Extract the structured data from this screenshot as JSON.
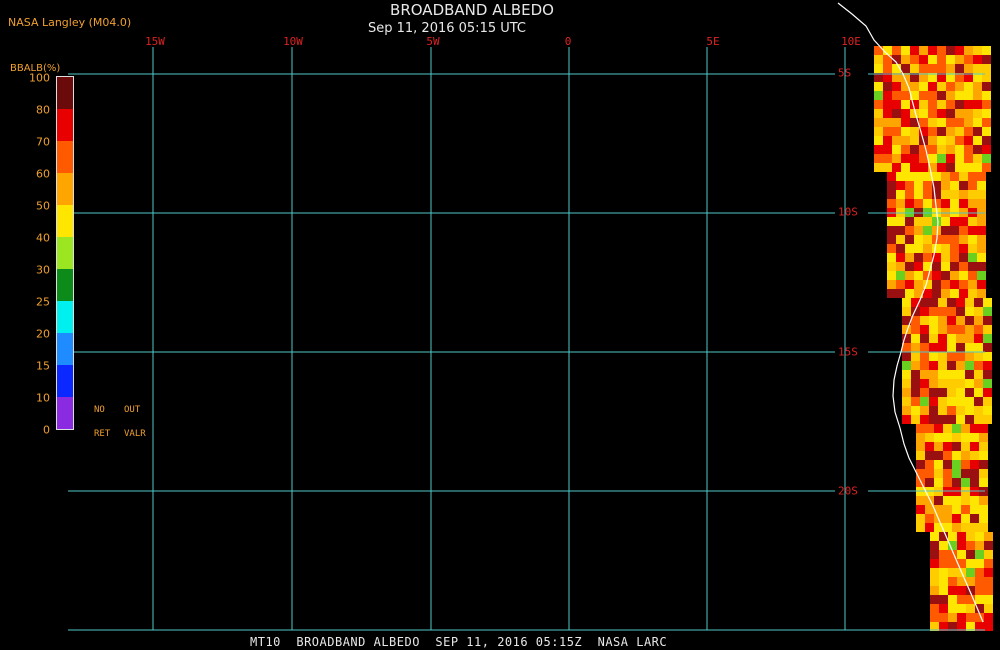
{
  "header": {
    "org": "NASA Langley (M04.0)",
    "title": "BROADBAND ALBEDO",
    "subtitle": "Sep 11, 2016 05:15 UTC"
  },
  "footer": {
    "text": "MT10  BROADBAND ALBEDO  SEP 11, 2016 05:15Z  NASA LARC"
  },
  "map": {
    "lon_labels": [
      "15W",
      "10W",
      "5W",
      "0",
      "5E",
      "10E"
    ],
    "lat_labels": [
      "5S",
      "10S",
      "15S",
      "20S"
    ],
    "grid_color": "#4fc8c8",
    "label_color": "#dd2222",
    "coastline_color": "#ffffff"
  },
  "legend": {
    "title": "BBALB(%)",
    "ticks": [
      "100",
      "80",
      "70",
      "60",
      "50",
      "40",
      "30",
      "25",
      "20",
      "15",
      "10",
      "0"
    ],
    "colors": [
      "#6a0a0a",
      "#e80000",
      "#ff5a00",
      "#ffa500",
      "#ffe600",
      "#9be620",
      "#0c8a1a",
      "#00f0f0",
      "#1e8cff",
      "#0a28ff",
      "#8a2be2"
    ],
    "no_label": "NO",
    "ret_label": "RET",
    "out_label": "OUT",
    "valr_label": "VALR"
  }
}
